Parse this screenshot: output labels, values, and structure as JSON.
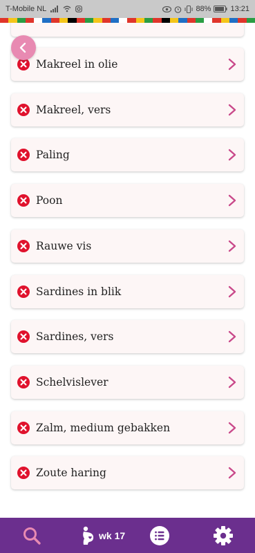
{
  "status_bar": {
    "carrier": "T-Mobile  NL",
    "battery": "88%",
    "time": "13:21"
  },
  "stripe_colors": [
    "#e0352b",
    "#f4c51a",
    "#2a9d43",
    "#e0352b",
    "#ffffff",
    "#1f6fc5",
    "#e0352b",
    "#f4c51a",
    "#000000",
    "#e0352b",
    "#2a9d43",
    "#f4c51a",
    "#e0352b",
    "#1f6fc5",
    "#ffffff",
    "#e0352b",
    "#f4c51a",
    "#2a9d43",
    "#e0352b",
    "#000000",
    "#f4c51a",
    "#1f6fc5",
    "#e0352b",
    "#2a9d43",
    "#ffffff",
    "#e0352b",
    "#f4c51a",
    "#1f6fc5",
    "#e0352b",
    "#2a9d43"
  ],
  "list": {
    "items": [
      {
        "label": "Makreel in olie",
        "status": "not-allowed"
      },
      {
        "label": "Makreel, vers",
        "status": "not-allowed"
      },
      {
        "label": "Paling",
        "status": "not-allowed"
      },
      {
        "label": "Poon",
        "status": "not-allowed"
      },
      {
        "label": "Rauwe vis",
        "status": "not-allowed"
      },
      {
        "label": "Sardines in blik",
        "status": "not-allowed"
      },
      {
        "label": "Sardines, vers",
        "status": "not-allowed"
      },
      {
        "label": "Schelvislever",
        "status": "not-allowed"
      },
      {
        "label": "Zalm, medium gebakken",
        "status": "not-allowed"
      },
      {
        "label": "Zoute haring",
        "status": "not-allowed"
      }
    ]
  },
  "nav": {
    "week_label": "wk 17",
    "icons": [
      "search-icon",
      "pregnancy-icon",
      "list-icon",
      "gear-icon"
    ]
  },
  "colors": {
    "nav_bg": "#6b2f8e",
    "accent_pink": "#e88ab2",
    "chevron": "#c9498a",
    "not_allowed_red": "#e0122d"
  }
}
